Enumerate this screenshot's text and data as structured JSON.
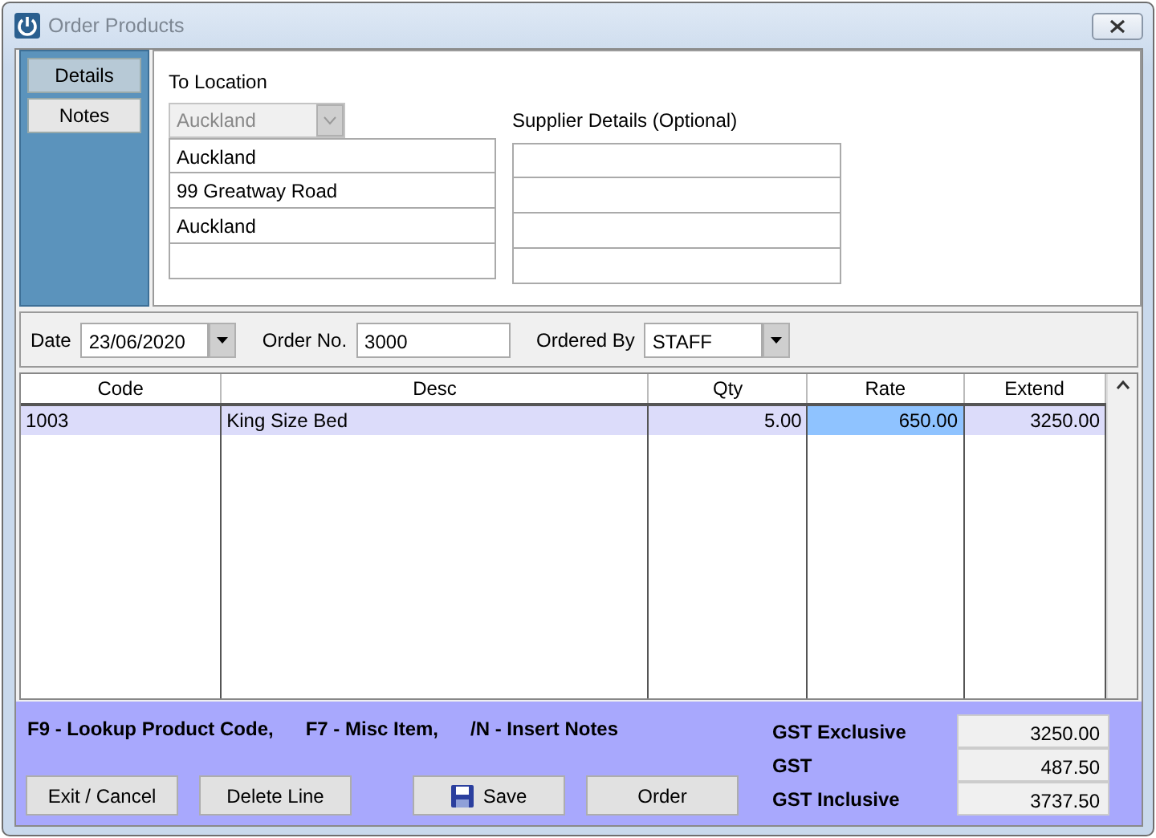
{
  "window": {
    "title": "Order Products"
  },
  "sidebar": {
    "tabs": [
      {
        "label": "Details",
        "selected": true
      },
      {
        "label": "Notes",
        "selected": false
      }
    ]
  },
  "location": {
    "label": "To Location",
    "select": {
      "value": "Auckland",
      "disabled": true
    },
    "lines": [
      {
        "kind": "text",
        "value": "Auckland"
      },
      {
        "kind": "text",
        "value": "99 Greatway Road"
      },
      {
        "kind": "text",
        "value": "Auckland"
      },
      {
        "kind": "empty"
      }
    ]
  },
  "supplier": {
    "label": "Supplier Details (Optional)",
    "lines": [
      {
        "kind": "empty"
      },
      {
        "kind": "empty"
      },
      {
        "kind": "empty"
      },
      {
        "kind": "empty"
      }
    ]
  },
  "order": {
    "date_label": "Date",
    "date": "23/06/2020",
    "number_label": "Order No.",
    "number": "3000",
    "ordered_by_label": "Ordered By",
    "ordered_by": "STAFF"
  },
  "table": {
    "columns": [
      "Code",
      "Desc",
      "Qty",
      "Rate",
      "Extend"
    ],
    "rows": [
      {
        "selected": true,
        "cells": [
          {
            "text": "1003",
            "selected": false
          },
          {
            "text": "King Size Bed",
            "selected": false
          },
          {
            "text": "5.00",
            "selected": false
          },
          {
            "text": "650.00",
            "selected": true
          },
          {
            "text": "3250.00",
            "selected": false
          }
        ]
      }
    ]
  },
  "hints": [
    "F9 - Lookup Product Code,",
    "F7 - Misc Item,",
    "/N - Insert Notes"
  ],
  "buttons": [
    {
      "label": "Exit / Cancel",
      "kind": "plain"
    },
    {
      "label": "Delete Line",
      "kind": "plain"
    },
    {
      "label": "Save",
      "kind": "save"
    },
    {
      "label": "Order",
      "kind": "plain"
    }
  ],
  "totals": [
    {
      "label": "GST Exclusive",
      "value": "3250.00"
    },
    {
      "label": "GST",
      "value": "487.50"
    },
    {
      "label": "GST Inclusive",
      "value": "3737.50"
    }
  ]
}
